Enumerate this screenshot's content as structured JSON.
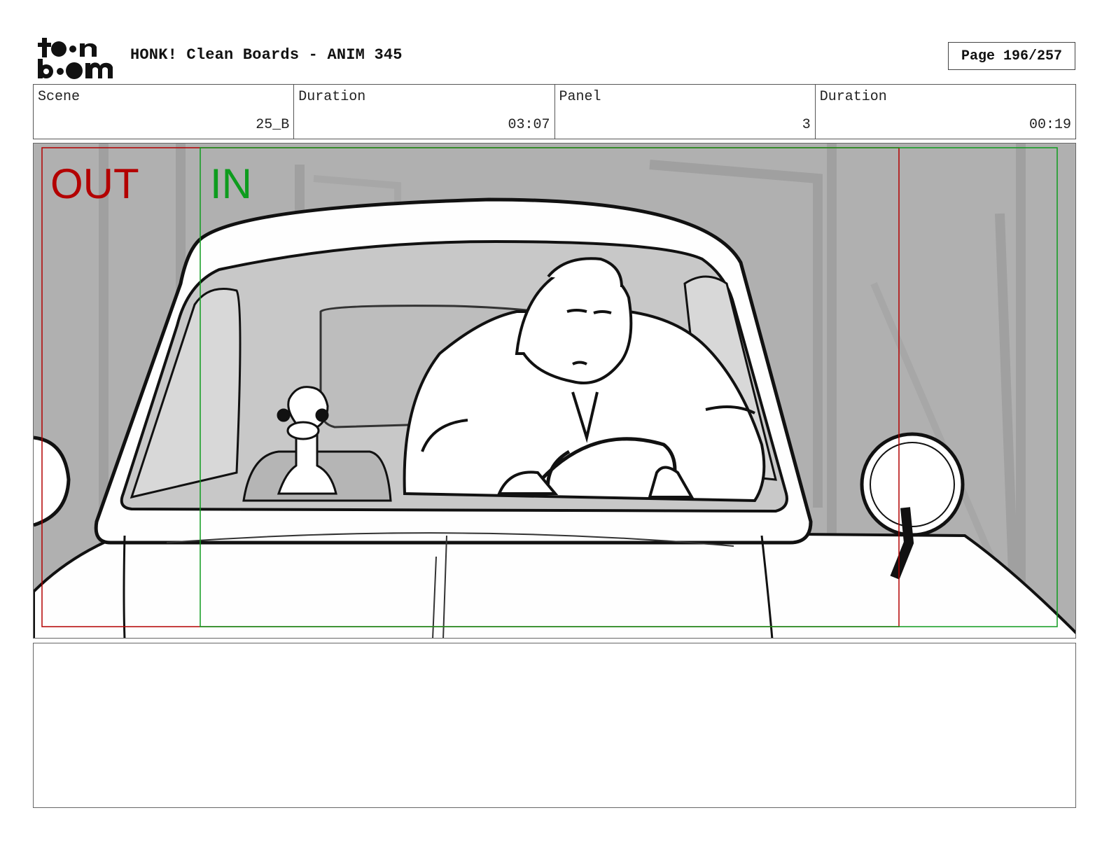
{
  "header": {
    "logo_text": "toon boom",
    "title": "HONK! Clean Boards - ANIM 345",
    "page": "Page 196/257"
  },
  "info": {
    "scene_label": "Scene",
    "scene_value": "25_B",
    "duration_label": "Duration",
    "duration_value": "03:07",
    "panel_label": "Panel",
    "panel_value": "3",
    "panel_duration_label": "Duration",
    "panel_duration_value": "00:19"
  },
  "panel": {
    "out_label": "OUT",
    "in_label": "IN",
    "colors": {
      "out": "#b30000",
      "in": "#0e9c1e",
      "bg": "#b3b3b3"
    }
  },
  "notes": {
    "text": ""
  }
}
